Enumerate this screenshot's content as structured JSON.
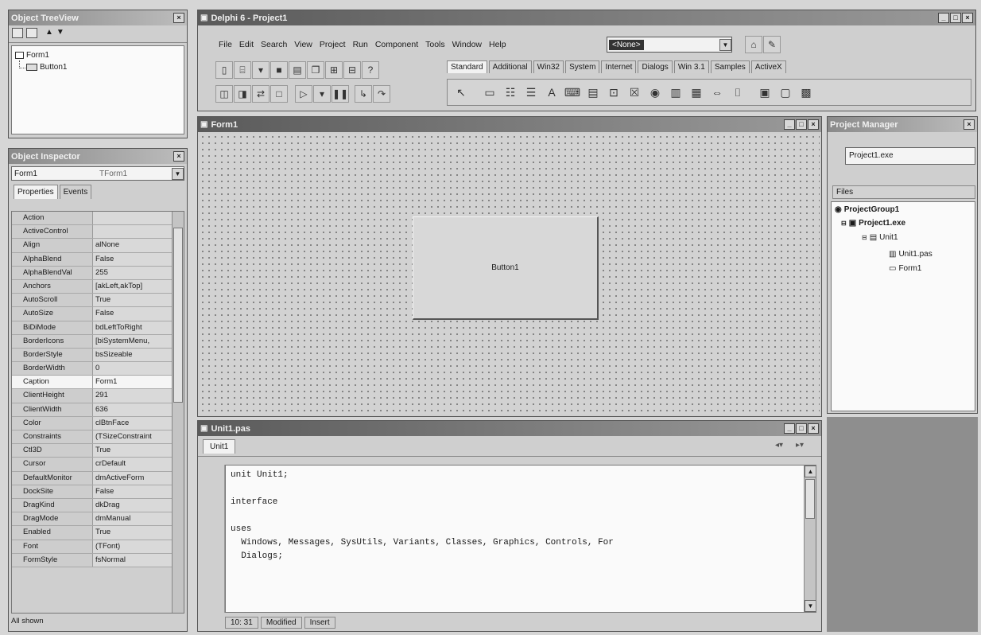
{
  "object_treeview": {
    "title": "Object TreeView",
    "items": [
      "Form1",
      "Button1"
    ]
  },
  "object_inspector": {
    "title": "Object Inspector",
    "selector": {
      "name": "Form1",
      "type": "TForm1"
    },
    "tabs": [
      "Properties",
      "Events"
    ],
    "properties": [
      {
        "name": "Action",
        "value": ""
      },
      {
        "name": "ActiveControl",
        "value": ""
      },
      {
        "name": "Align",
        "value": "alNone"
      },
      {
        "name": "AlphaBlend",
        "value": "False"
      },
      {
        "name": "AlphaBlendVal",
        "value": "255"
      },
      {
        "name": "Anchors",
        "value": "[akLeft,akTop]"
      },
      {
        "name": "AutoScroll",
        "value": "True"
      },
      {
        "name": "AutoSize",
        "value": "False"
      },
      {
        "name": "BiDiMode",
        "value": "bdLeftToRight"
      },
      {
        "name": "BorderIcons",
        "value": "[biSystemMenu,"
      },
      {
        "name": "BorderStyle",
        "value": "bsSizeable"
      },
      {
        "name": "BorderWidth",
        "value": "0"
      },
      {
        "name": "Caption",
        "value": "Form1"
      },
      {
        "name": "ClientHeight",
        "value": "291"
      },
      {
        "name": "ClientWidth",
        "value": "636"
      },
      {
        "name": "Color",
        "value": "clBtnFace"
      },
      {
        "name": "Constraints",
        "value": "(TSizeConstraint"
      },
      {
        "name": "Ctl3D",
        "value": "True"
      },
      {
        "name": "Cursor",
        "value": "crDefault"
      },
      {
        "name": "DefaultMonitor",
        "value": "dmActiveForm"
      },
      {
        "name": "DockSite",
        "value": "False"
      },
      {
        "name": "DragKind",
        "value": "dkDrag"
      },
      {
        "name": "DragMode",
        "value": "dmManual"
      },
      {
        "name": "Enabled",
        "value": "True"
      },
      {
        "name": "Font",
        "value": "(TFont)"
      },
      {
        "name": "FormStyle",
        "value": "fsNormal"
      }
    ],
    "status": "All shown"
  },
  "main_window": {
    "title": "Delphi 6 - Project1",
    "menu": [
      "File",
      "Edit",
      "Search",
      "View",
      "Project",
      "Run",
      "Component",
      "Tools",
      "Window",
      "Help"
    ],
    "desktop_select": "<None>",
    "palette_tabs": [
      "Standard",
      "Additional",
      "Win32",
      "System",
      "Internet",
      "Dialogs",
      "Win 3.1",
      "Samples",
      "ActiveX"
    ]
  },
  "form_designer": {
    "title": "Form1",
    "button_caption": "Button1"
  },
  "code_editor": {
    "title": "Unit1.pas",
    "tab": "Unit1",
    "lines": [
      "unit Unit1;",
      "",
      "interface",
      "",
      "uses",
      "  Windows, Messages, SysUtils, Variants, Classes, Graphics, Controls, For",
      "  Dialogs;"
    ],
    "status": {
      "position": "10: 31",
      "modified": "Modified",
      "mode": "Insert"
    }
  },
  "project_manager": {
    "title": "Project Manager",
    "project_select": "Project1.exe",
    "files_label": "Files",
    "tree": [
      "ProjectGroup1",
      "Project1.exe",
      "Unit1",
      "Unit1.pas",
      "Form1"
    ]
  }
}
